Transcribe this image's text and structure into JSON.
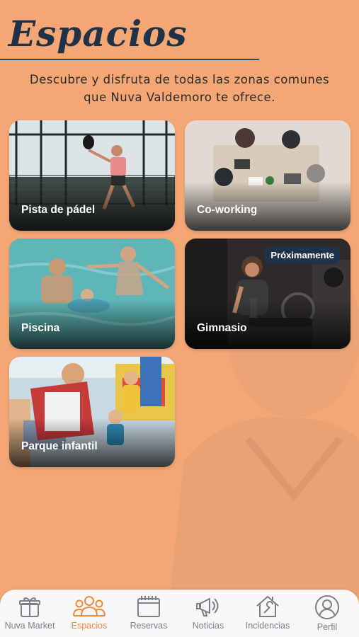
{
  "header": {
    "title": "Espacios",
    "subtitle": "Descubre y disfruta de todas las zonas comunes que Nuva Valdemoro te ofrece."
  },
  "spaces": [
    {
      "label": "Pista de pádel"
    },
    {
      "label": "Co-working"
    },
    {
      "label": "Piscina"
    },
    {
      "label": "Gimnasio",
      "badge": "Próximamente"
    },
    {
      "label": "Parque infantil"
    }
  ],
  "tabbar": {
    "items": [
      {
        "label": "Nuva Market",
        "icon": "gift-icon"
      },
      {
        "label": "Espacios",
        "icon": "people-icon",
        "active": true
      },
      {
        "label": "Reservas",
        "icon": "calendar-icon"
      },
      {
        "label": "Noticias",
        "icon": "megaphone-icon"
      },
      {
        "label": "Incidencias",
        "icon": "house-wrench-icon"
      },
      {
        "label": "Perfil",
        "icon": "user-icon"
      }
    ]
  },
  "colors": {
    "background": "#F4A774",
    "accent": "#F08A3C",
    "navy": "#1F3247"
  }
}
